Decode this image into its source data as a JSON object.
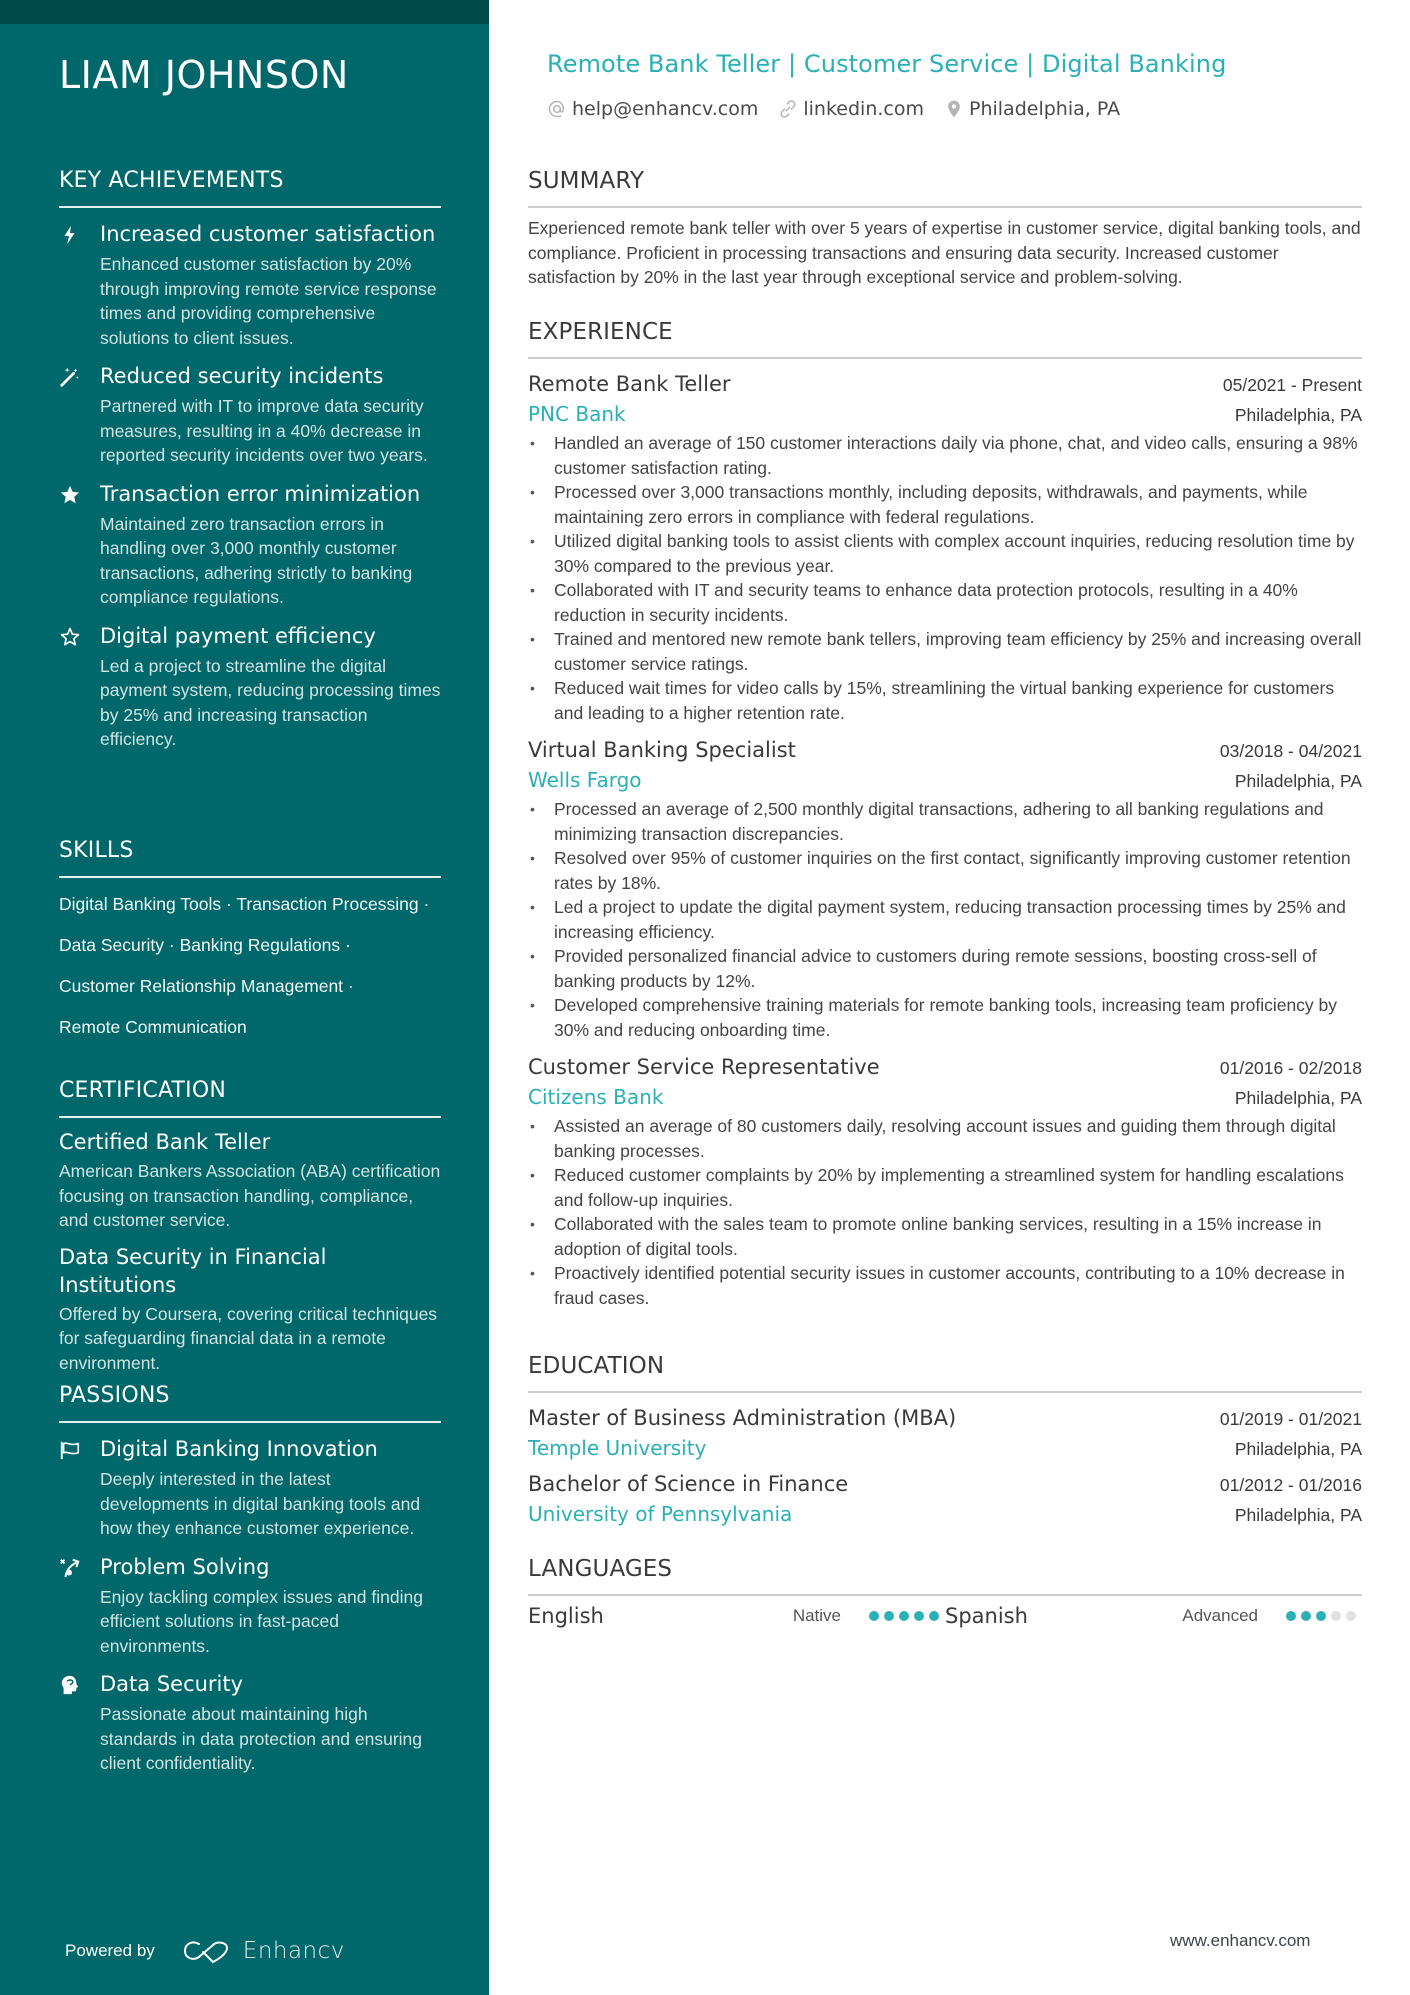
{
  "profile": {
    "name": "LIAM JOHNSON",
    "headline": "Remote Bank Teller | Customer Service | Digital Banking",
    "contacts": [
      {
        "icon": "at-icon",
        "text": "help@enhancv.com"
      },
      {
        "icon": "link-icon",
        "text": "linkedin.com"
      },
      {
        "icon": "location-pin-icon",
        "text": "Philadelphia, PA"
      }
    ]
  },
  "colors": {
    "sidebar_bg": "#00676a",
    "sidebar_top_band": "#004a4c",
    "accent": "#2bb0b6",
    "dot_inactive": "#e2e2e2"
  },
  "sidebar": {
    "achievements": {
      "heading": "KEY ACHIEVEMENTS",
      "items": [
        {
          "icon": "lightning-bolt-icon",
          "title": "Increased customer satisfaction",
          "desc": "Enhanced customer satisfaction by 20% through improving remote service response times and providing comprehensive solutions to client issues."
        },
        {
          "icon": "magic-wand-icon",
          "title": "Reduced security incidents",
          "desc": "Partnered with IT to improve data security measures, resulting in a 40% decrease in reported security incidents over two years."
        },
        {
          "icon": "star-filled-icon",
          "title": "Transaction error minimization",
          "desc": "Maintained zero transaction errors in handling over 3,000 monthly customer transactions, adhering strictly to banking compliance regulations."
        },
        {
          "icon": "star-outline-icon",
          "title": "Digital payment efficiency",
          "desc": "Led a project to streamline the digital payment system, reducing processing times by 25% and increasing transaction efficiency."
        }
      ]
    },
    "skills": {
      "heading": "SKILLS",
      "lines": [
        "Digital Banking Tools · Transaction Processing ·",
        "Data Security · Banking Regulations ·",
        "Customer Relationship Management ·",
        "Remote Communication"
      ]
    },
    "certification": {
      "heading": "CERTIFICATION",
      "items": [
        {
          "title": "Certified Bank Teller",
          "desc": "American Bankers Association (ABA) certification focusing on transaction handling, compliance, and customer service."
        },
        {
          "title": "Data Security in Financial Institutions",
          "desc": "Offered by Coursera, covering critical techniques for safeguarding financial data in a remote environment."
        }
      ]
    },
    "passions": {
      "heading": "PASSIONS",
      "items": [
        {
          "icon": "flag-icon",
          "title": "Digital Banking Innovation",
          "desc": "Deeply interested in the latest developments in digital banking tools and how they enhance customer experience."
        },
        {
          "icon": "strategy-icon",
          "title": "Problem Solving",
          "desc": "Enjoy tackling complex issues and finding efficient solutions in fast-paced environments."
        },
        {
          "icon": "brain-head-icon",
          "title": "Data Security",
          "desc": "Passionate about maintaining high standards in data protection and ensuring client confidentiality."
        }
      ]
    },
    "footer": {
      "powered_by": "Powered by",
      "brand": "Enhancv"
    }
  },
  "main": {
    "summary": {
      "heading": "SUMMARY",
      "text": "Experienced remote bank teller with over 5 years of expertise in customer service, digital banking tools, and compliance. Proficient in processing transactions and ensuring data security. Increased customer satisfaction by 20% in the last year through exceptional service and problem-solving."
    },
    "experience": {
      "heading": "EXPERIENCE",
      "jobs": [
        {
          "title": "Remote Bank Teller",
          "dates": "05/2021 - Present",
          "company": "PNC Bank",
          "location": "Philadelphia, PA",
          "bullets": [
            "Handled an average of 150 customer interactions daily via phone, chat, and video calls, ensuring a 98% customer satisfaction rating.",
            "Processed over 3,000 transactions monthly, including deposits, withdrawals, and payments, while maintaining zero errors in compliance with federal regulations.",
            "Utilized digital banking tools to assist clients with complex account inquiries, reducing resolution time by 30% compared to the previous year.",
            "Collaborated with IT and security teams to enhance data protection protocols, resulting in a 40% reduction in security incidents.",
            "Trained and mentored new remote bank tellers, improving team efficiency by 25% and increasing overall customer service ratings.",
            "Reduced wait times for video calls by 15%, streamlining the virtual banking experience for customers and leading to a higher retention rate."
          ]
        },
        {
          "title": "Virtual Banking Specialist",
          "dates": "03/2018 - 04/2021",
          "company": "Wells Fargo",
          "location": "Philadelphia, PA",
          "bullets": [
            "Processed an average of 2,500 monthly digital transactions, adhering to all banking regulations and minimizing transaction discrepancies.",
            "Resolved over 95% of customer inquiries on the first contact, significantly improving customer retention rates by 18%.",
            "Led a project to update the digital payment system, reducing transaction processing times by 25% and increasing efficiency.",
            "Provided personalized financial advice to customers during remote sessions, boosting cross-sell of banking products by 12%.",
            "Developed comprehensive training materials for remote banking tools, increasing team proficiency by 30% and reducing onboarding time."
          ]
        },
        {
          "title": "Customer Service Representative",
          "dates": "01/2016 - 02/2018",
          "company": "Citizens Bank",
          "location": "Philadelphia, PA",
          "bullets": [
            "Assisted an average of 80 customers daily, resolving account issues and guiding them through digital banking processes.",
            "Reduced customer complaints by 20% by implementing a streamlined system for handling escalations and follow-up inquiries.",
            "Collaborated with the sales team to promote online banking services, resulting in a 15% increase in adoption of digital tools.",
            "Proactively identified potential security issues in customer accounts, contributing to a 10% decrease in fraud cases."
          ]
        }
      ]
    },
    "education": {
      "heading": "EDUCATION",
      "items": [
        {
          "degree": "Master of Business Administration (MBA)",
          "dates": "01/2019 - 01/2021",
          "school": "Temple University",
          "location": "Philadelphia, PA"
        },
        {
          "degree": "Bachelor of Science in Finance",
          "dates": "01/2012 - 01/2016",
          "school": "University of Pennsylvania",
          "location": "Philadelphia, PA"
        }
      ]
    },
    "languages": {
      "heading": "LANGUAGES",
      "items": [
        {
          "name": "English",
          "level": "Native",
          "rating": 5,
          "max": 5
        },
        {
          "name": "Spanish",
          "level": "Advanced",
          "rating": 3,
          "max": 5
        }
      ]
    },
    "footer_url": "www.enhancv.com"
  }
}
